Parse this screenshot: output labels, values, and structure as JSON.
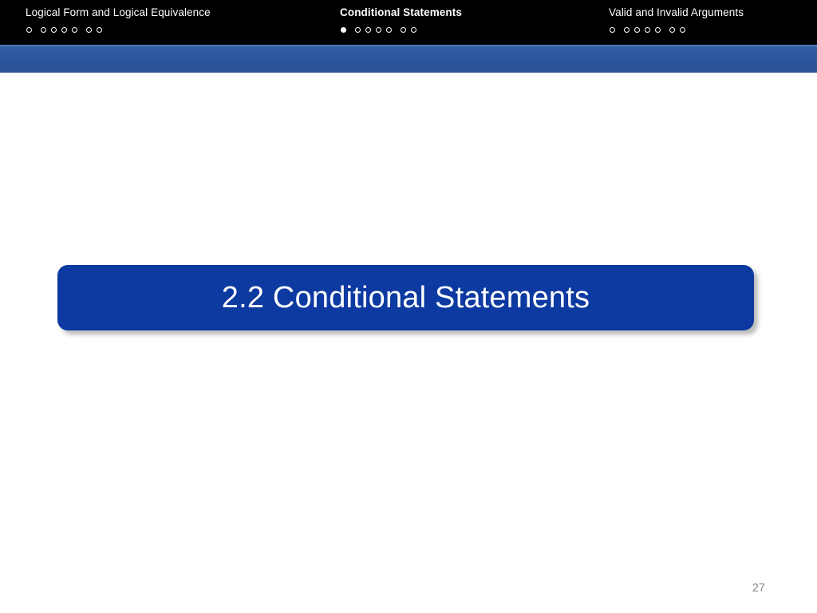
{
  "slide": {
    "page_number": "27",
    "colors": {
      "nav_background": "#000000",
      "accent_bar_top": "#3d6aab",
      "accent_bar_bottom": "#2b5294",
      "title_plate": "#0c3aa0",
      "title_text": "#ffffff",
      "page_number_text": "#8a8a8a",
      "body_background": "#ffffff"
    }
  },
  "nav": {
    "sections": [
      {
        "label": "Logical Form and Logical Equivalence",
        "active": false,
        "dots": [
          {
            "filled": false
          },
          {
            "filled": false
          },
          {
            "filled": false
          },
          {
            "filled": false
          },
          {
            "filled": false
          },
          {
            "filled": false
          },
          {
            "filled": false
          }
        ]
      },
      {
        "label": "Conditional Statements",
        "active": true,
        "dots": [
          {
            "filled": true
          },
          {
            "filled": false
          },
          {
            "filled": false
          },
          {
            "filled": false
          },
          {
            "filled": false
          },
          {
            "filled": false
          },
          {
            "filled": false
          }
        ]
      },
      {
        "label": "Valid and Invalid Arguments",
        "active": false,
        "dots": [
          {
            "filled": false
          },
          {
            "filled": false
          },
          {
            "filled": false
          },
          {
            "filled": false
          },
          {
            "filled": false
          },
          {
            "filled": false
          },
          {
            "filled": false
          }
        ]
      }
    ]
  },
  "main": {
    "title": "2.2 Conditional Statements"
  }
}
